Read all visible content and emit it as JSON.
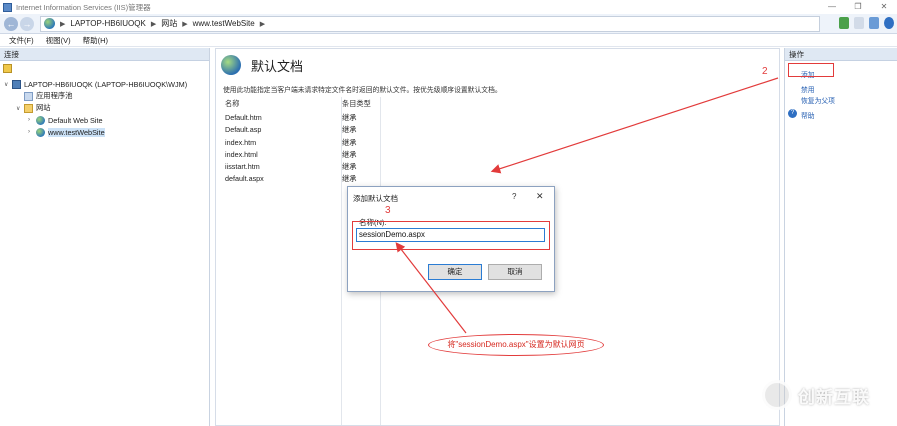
{
  "window": {
    "title": "Internet Information Services (IIS)管理器",
    "controls": [
      "—",
      "❐",
      "✕"
    ]
  },
  "address": {
    "crumbs": [
      "LAPTOP-HB6IUOQK",
      "网站",
      "www.testWebSite"
    ]
  },
  "menu": [
    "文件(F)",
    "视图(V)",
    "帮助(H)"
  ],
  "connections": {
    "header": "连接",
    "tree": [
      {
        "label": "LAPTOP-HB6IUOQK (LAPTOP-HB6IUOQK\\WJM)",
        "icon": "server-icon",
        "expander": "∨"
      },
      {
        "label": "应用程序池",
        "icon": "app-pool-icon",
        "expander": ""
      },
      {
        "label": "网站",
        "icon": "folder-icon",
        "expander": "∨"
      },
      {
        "label": "Default Web Site",
        "icon": "site-icon",
        "expander": "›"
      },
      {
        "label": "www.testWebSite",
        "icon": "site-icon",
        "expander": "›",
        "selected": true
      }
    ]
  },
  "content": {
    "title": "默认文档",
    "description": "使用此功能指定当客户端未请求特定文件名时返回的默认文件。按优先级顺序设置默认文档。",
    "columns": [
      "名称",
      "条目类型"
    ],
    "rows": [
      {
        "name": "Default.htm",
        "type": "继承"
      },
      {
        "name": "Default.asp",
        "type": "继承"
      },
      {
        "name": "index.htm",
        "type": "继承"
      },
      {
        "name": "index.html",
        "type": "继承"
      },
      {
        "name": "iisstart.htm",
        "type": "继承"
      },
      {
        "name": "default.aspx",
        "type": "继承"
      }
    ]
  },
  "actions": {
    "header": "操作",
    "items": [
      "添加...",
      "禁用",
      "恢复为父项",
      "帮助"
    ]
  },
  "dialog": {
    "title": "添加默认文档",
    "help": "?",
    "close": "✕",
    "label": "名称(N):",
    "value": "sessionDemo.aspx",
    "ok": "确定",
    "cancel": "取消"
  },
  "annotations": {
    "step2": "2",
    "step3": "3",
    "note": "将\"sessionDemo.aspx\"设置为默认网页",
    "color": "#e23b3b"
  },
  "watermark": {
    "text": "创新互联"
  }
}
